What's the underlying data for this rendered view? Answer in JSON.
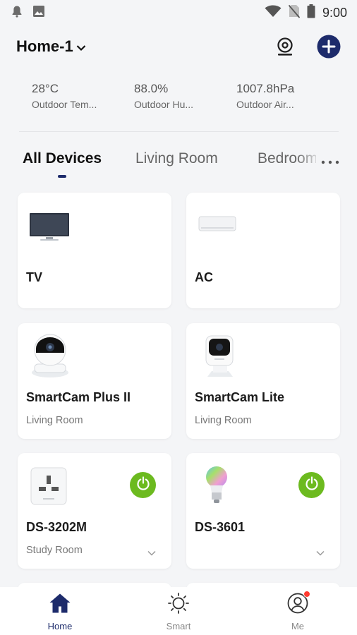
{
  "status_bar": {
    "time": "9:00",
    "icons": [
      "notification-bell-icon",
      "image-icon",
      "wifi-icon",
      "no-sim-icon",
      "battery-icon"
    ]
  },
  "header": {
    "home_name": "Home-1",
    "icons": [
      "chevron-down-icon",
      "camera-icon",
      "add-icon"
    ],
    "accent_color": "#1d2b6b"
  },
  "weather": [
    {
      "value": "28°C",
      "label": "Outdoor Tem..."
    },
    {
      "value": "88.0%",
      "label": "Outdoor Hu..."
    },
    {
      "value": "1007.8hPa",
      "label": "Outdoor Air..."
    }
  ],
  "tabs": [
    {
      "label": "All Devices",
      "active": true
    },
    {
      "label": "Living Room",
      "active": false
    },
    {
      "label": "Bedroom",
      "active": false
    }
  ],
  "devices": [
    {
      "name": "TV",
      "room": "",
      "icon": "tv-icon"
    },
    {
      "name": "AC",
      "room": "",
      "icon": "air-conditioner-icon"
    },
    {
      "name": "SmartCam Plus II",
      "room": "Living Room",
      "icon": "pan-tilt-camera-icon"
    },
    {
      "name": "SmartCam Lite",
      "room": "Living Room",
      "icon": "cube-camera-icon"
    },
    {
      "name": "DS-3202M",
      "room": "Study Room",
      "icon": "smart-plug-icon",
      "power": true
    },
    {
      "name": "DS-3601",
      "room": "",
      "icon": "smart-bulb-icon",
      "power": true
    }
  ],
  "power_color": "#6cba1f",
  "bottom_nav": [
    {
      "label": "Home",
      "icon": "home-icon",
      "active": true
    },
    {
      "label": "Smart",
      "icon": "sun-icon",
      "active": false
    },
    {
      "label": "Me",
      "icon": "user-icon",
      "active": false,
      "badge": true
    }
  ]
}
